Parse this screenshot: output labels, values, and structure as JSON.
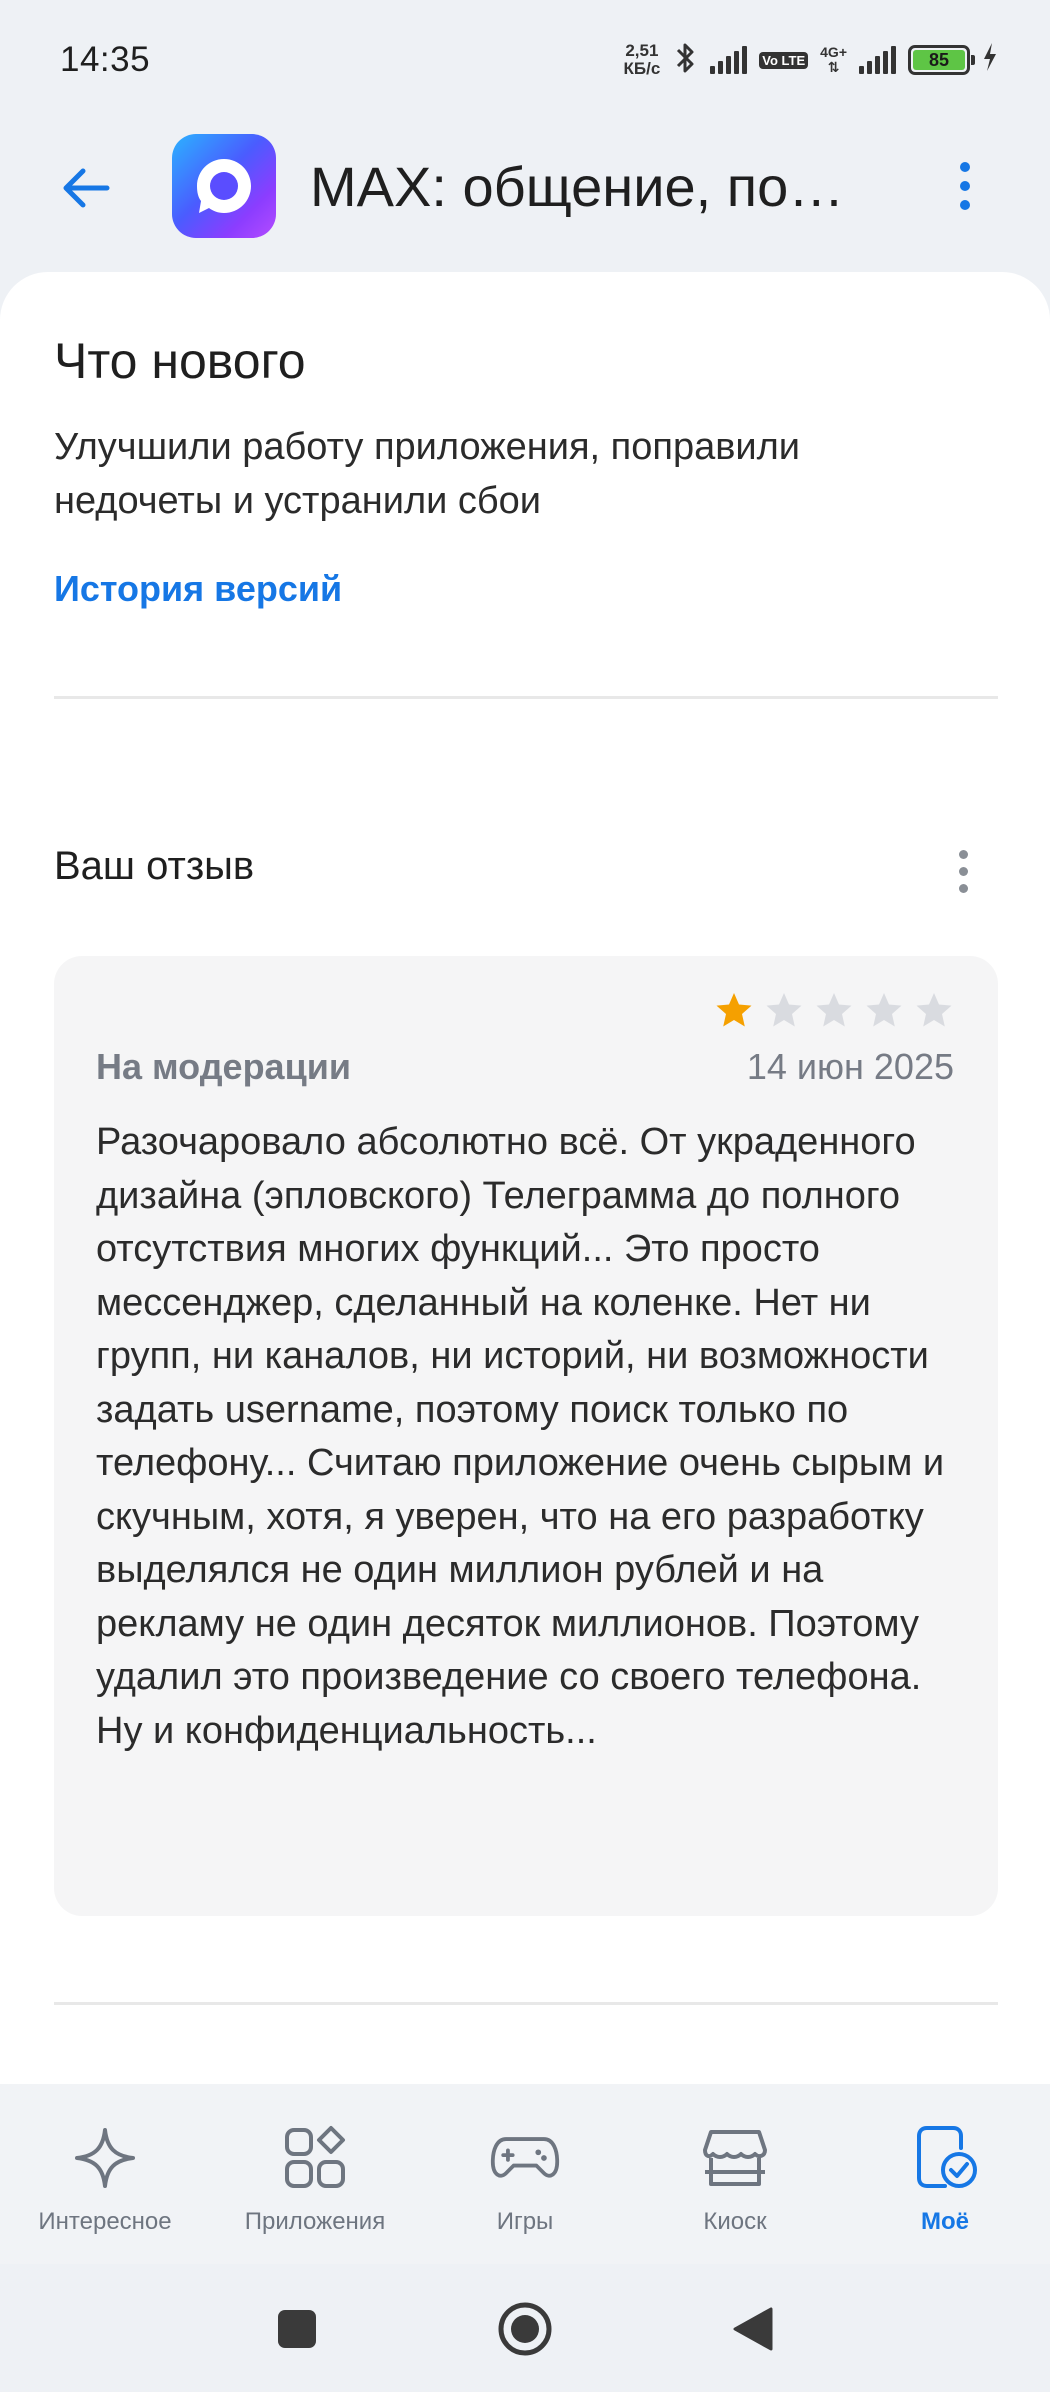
{
  "status_bar": {
    "time": "14:35",
    "net_speed_value": "2,51",
    "net_speed_unit": "КБ/с",
    "volte_label": "Vo LTE",
    "network_label": "4G+",
    "battery_percent": "85"
  },
  "header": {
    "app_title": "MAX: общение, по…"
  },
  "whats_new": {
    "title": "Что нового",
    "text": "Улучшили работу приложения, поправили недочеты и устранили сбои",
    "history_link": "История версий"
  },
  "review": {
    "heading": "Ваш отзыв",
    "rating": 1,
    "max_rating": 5,
    "status": "На модерации",
    "date": "14 июн 2025",
    "text": "Разочаровало абсолютно всё. От украденного дизайна (эпловского) Телеграмма до полного отсутствия многих функций... Это просто мессенджер, сделанный на коленке. Нет ни групп, ни каналов, ни историй, ни возможности задать username, поэтому поиск только по телефону... Считаю приложение очень сырым и скучным, хотя, я уверен, что на его разработку выделялся не один миллион рублей и на рекламу не один десяток миллионов. Поэтому удалил это произведение со своего телефона. Ну и конфиденциальность..."
  },
  "bottom_nav": {
    "items": [
      {
        "label": "Интересное",
        "icon": "sparkle-icon"
      },
      {
        "label": "Приложения",
        "icon": "apps-grid-icon"
      },
      {
        "label": "Игры",
        "icon": "gamepad-icon"
      },
      {
        "label": "Киоск",
        "icon": "store-icon"
      },
      {
        "label": "Моё",
        "icon": "my-apps-check-icon"
      }
    ],
    "active_index": 4
  },
  "colors": {
    "accent": "#1677e5",
    "star_filled": "#f5a000",
    "star_empty": "#d9dbe0",
    "battery": "#5ec545"
  }
}
